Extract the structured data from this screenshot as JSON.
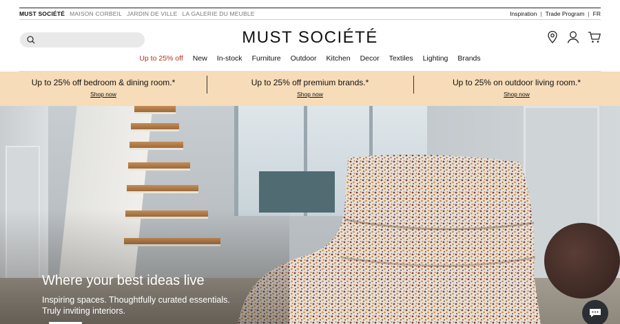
{
  "topbar": {
    "brands": [
      "MUST SOCIÉTÉ",
      "MAISON CORBEIL",
      "JARDIN DE VILLE",
      "LA GALERIE DU MEUBLE"
    ],
    "links": [
      "Inspiration",
      "Trade Program",
      "FR"
    ],
    "separator": "|"
  },
  "header": {
    "logo": "MUST SOCIÉTÉ",
    "search_placeholder": "",
    "icons": [
      "search-icon",
      "location-pin-icon",
      "account-icon",
      "cart-icon"
    ]
  },
  "nav": {
    "promo": "Up to 25% off",
    "items": [
      "New",
      "In-stock",
      "Furniture",
      "Outdoor",
      "Kitchen",
      "Decor",
      "Textiles",
      "Lighting",
      "Brands"
    ]
  },
  "promo_band": {
    "background": "#f6dcb8",
    "items": [
      {
        "title": "Up to 25% off bedroom & dining room.*",
        "link": "Shop now"
      },
      {
        "title": "Up to 25% off premium brands.*",
        "link": "Shop now"
      },
      {
        "title": "Up to 25% on outdoor living room.*",
        "link": "Shop now"
      }
    ]
  },
  "hero": {
    "title": "Where your best ideas live",
    "subtitle_line1": "Inspiring spaces. Thoughtfully curated essentials.",
    "subtitle_line2": "Truly inviting interiors."
  },
  "colors": {
    "promo_red": "#b0321e",
    "text": "#111111"
  }
}
